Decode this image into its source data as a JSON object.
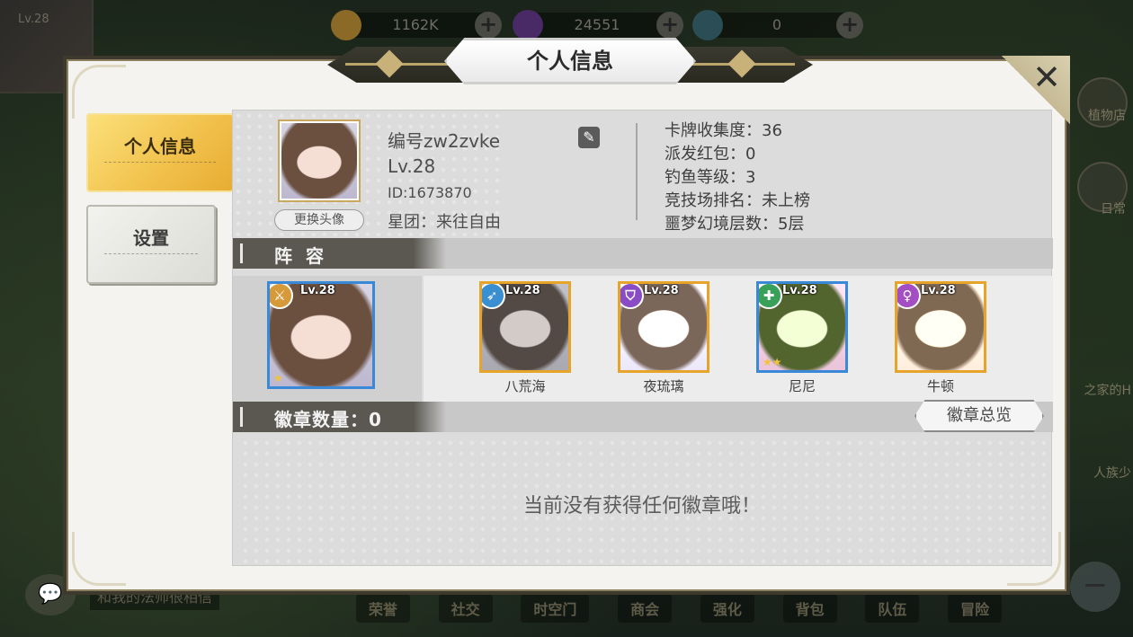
{
  "background": {
    "player_level": "Lv.28",
    "resources": [
      {
        "icon": "gold-coin-icon",
        "value": "1162K",
        "color": "#d4a137"
      },
      {
        "icon": "purple-gem-icon",
        "value": "24551",
        "color": "#7c3fb4"
      },
      {
        "icon": "rainbow-orb-icon",
        "value": "0",
        "color": "#4ab7c8"
      }
    ],
    "side_labels": [
      "植物店",
      "日常",
      "之家的H",
      "人族少"
    ],
    "bottom_nav": [
      "荣誉",
      "社交",
      "时空门",
      "商会",
      "强化",
      "背包",
      "队伍",
      "冒险"
    ],
    "chat_preview": "和我的法师很相信"
  },
  "dialog": {
    "title": "个人信息",
    "close_symbol": "✕",
    "tabs": [
      {
        "label": "个人信息",
        "active": true
      },
      {
        "label": "设置",
        "active": false
      }
    ],
    "profile": {
      "name": "编号zw2zvke",
      "level": "Lv.28",
      "id": "ID:1673870",
      "guild": "星团：来往自由",
      "change_avatar": "更换头像"
    },
    "stats": [
      "卡牌收集度：36",
      "派发红包：0",
      "钓鱼等级：3",
      "竞技场排名：未上榜",
      "噩梦幻境层数：5层"
    ],
    "team": {
      "header": "阵 容",
      "leader": {
        "level": "Lv.28",
        "class_icon": "sword-class-icon",
        "class_color": "#d69a3a",
        "stars": "★"
      },
      "members": [
        {
          "name": "八荒海",
          "level": "Lv.28",
          "class_icon": "bow-class-icon",
          "class_color": "#3a8fd0",
          "stars": ""
        },
        {
          "name": "夜琉璃",
          "level": "Lv.28",
          "class_icon": "shield-class-icon",
          "class_color": "#8a4cc4",
          "stars": ""
        },
        {
          "name": "尼尼",
          "level": "Lv.28",
          "class_icon": "heal-cross-class-icon",
          "class_color": "#39a05a",
          "stars": "★★"
        },
        {
          "name": "牛顿",
          "level": "Lv.28",
          "class_icon": "mage-class-icon",
          "class_color": "#a44ec4",
          "stars": ""
        }
      ]
    },
    "badges": {
      "header": "徽章数量：0",
      "overview_button": "徽章总览",
      "empty_message": "当前没有获得任何徽章哦！"
    }
  }
}
